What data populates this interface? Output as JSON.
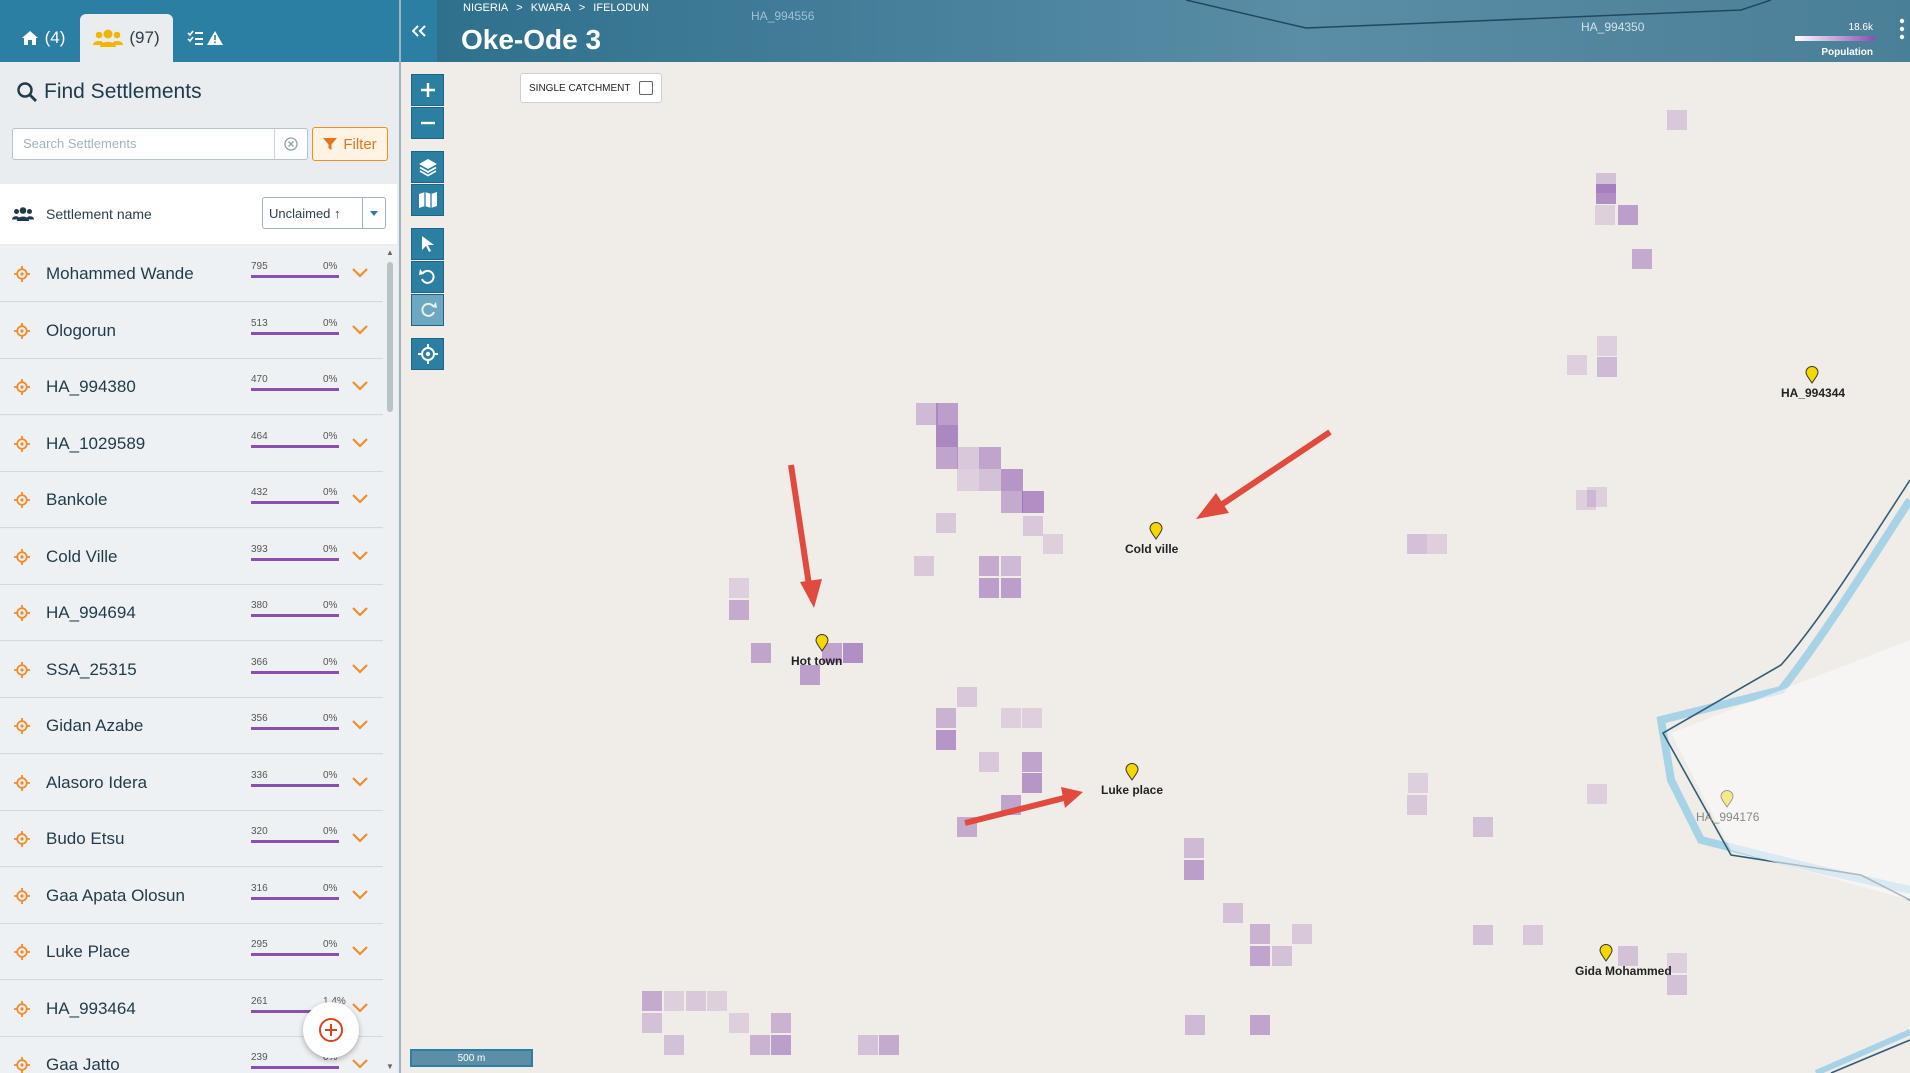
{
  "tabs": [
    {
      "icon": "home-icon",
      "label": "(4)"
    },
    {
      "icon": "people-icon",
      "label": "(97)"
    },
    {
      "icon": "checklist-warning-icon",
      "label": ""
    }
  ],
  "find": {
    "title": "Find Settlements",
    "search_placeholder": "Search Settlements",
    "filter_label": "Filter"
  },
  "list_header": {
    "label": "Settlement name",
    "sort_value": "Unclaimed ↑"
  },
  "settlements": [
    {
      "name": "Mohammed Wande",
      "population": "795",
      "percent": "0%"
    },
    {
      "name": "Ologorun",
      "population": "513",
      "percent": "0%"
    },
    {
      "name": "HA_994380",
      "population": "470",
      "percent": "0%"
    },
    {
      "name": "HA_1029589",
      "population": "464",
      "percent": "0%"
    },
    {
      "name": "Bankole",
      "population": "432",
      "percent": "0%"
    },
    {
      "name": "Cold Ville",
      "population": "393",
      "percent": "0%"
    },
    {
      "name": "HA_994694",
      "population": "380",
      "percent": "0%"
    },
    {
      "name": "SSA_25315",
      "population": "366",
      "percent": "0%"
    },
    {
      "name": "Gidan Azabe",
      "population": "356",
      "percent": "0%"
    },
    {
      "name": "Alasoro Idera",
      "population": "336",
      "percent": "0%"
    },
    {
      "name": "Budo Etsu",
      "population": "320",
      "percent": "0%"
    },
    {
      "name": "Gaa Apata Olosun",
      "population": "316",
      "percent": "0%"
    },
    {
      "name": "Luke Place",
      "population": "295",
      "percent": "0%"
    },
    {
      "name": "HA_993464",
      "population": "261",
      "percent": "1.4%"
    },
    {
      "name": "Gaa Jatto",
      "population": "239",
      "percent": "0%"
    }
  ],
  "map": {
    "breadcrumb": [
      "NIGERIA",
      ">",
      "KWARA",
      ">",
      "IFELODUN"
    ],
    "title": "Oke-Ode 3",
    "legend": {
      "max": "18.6k",
      "label": "Population"
    },
    "catchment_label": "SINGLE CATCHMENT",
    "scale": "500 m",
    "labels": [
      "Cold ville",
      "Hot town",
      "Luke place",
      "HA_994344",
      "HA_994176",
      "Gida Mohammed",
      "HA_994350",
      "HA_994556"
    ]
  },
  "colors": {
    "primary": "#2b7fa3",
    "accent": "#f28c28",
    "population": "#8a4fb0",
    "annotation_arrow": "#e04a3f"
  }
}
